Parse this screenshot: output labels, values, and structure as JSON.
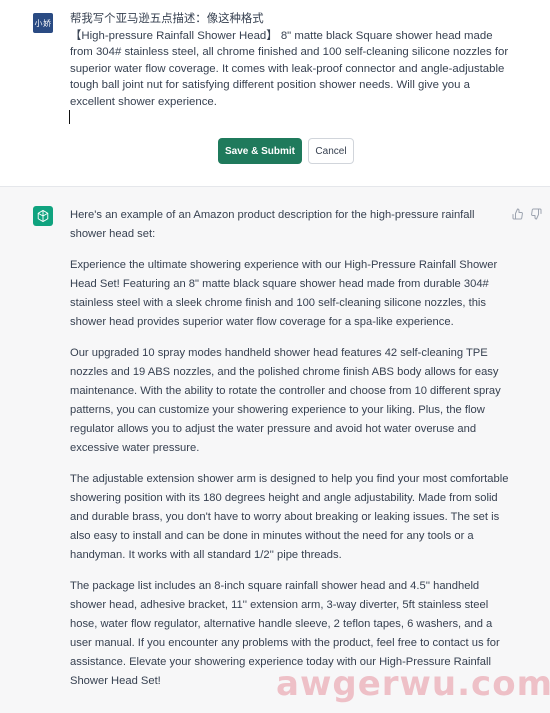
{
  "user": {
    "avatar_label": "小娇",
    "line1": "帮我写个亚马逊五点描述：像这种格式",
    "line2": "【High-pressure Rainfall Shower Head】 8\" matte black Square shower head made from 304# stainless steel, all chrome finished and 100 self-cleaning silicone nozzles for superior water flow coverage. It comes with leak-proof connector and angle-adjustable tough ball joint nut for satisfying different position shower needs. Will give you a excellent shower experience."
  },
  "buttons": {
    "save": "Save & Submit",
    "cancel": "Cancel"
  },
  "assistant": {
    "paragraphs": [
      "Here's an example of an Amazon product description for the high-pressure rainfall shower head set:",
      "Experience the ultimate showering experience with our High-Pressure Rainfall Shower Head Set! Featuring an 8\" matte black square shower head made from durable 304# stainless steel with a sleek chrome finish and 100 self-cleaning silicone nozzles, this shower head provides superior water flow coverage for a spa-like experience.",
      "Our upgraded 10 spray modes handheld shower head features 42 self-cleaning TPE nozzles and 19 ABS nozzles, and the polished chrome finish ABS body allows for easy maintenance. With the ability to rotate the controller and choose from 10 different spray patterns, you can customize your showering experience to your liking. Plus, the flow regulator allows you to adjust the water pressure and avoid hot water overuse and excessive water pressure.",
      "The adjustable extension shower arm is designed to help you find your most comfortable showering position with its 180 degrees height and angle adjustability. Made from solid and durable brass, you don't have to worry about breaking or leaking issues. The set is also easy to install and can be done in minutes without the need for any tools or a handyman. It works with all standard 1/2'' pipe threads.",
      "The package list includes an 8-inch square rainfall shower head and 4.5'' handheld shower head, adhesive bracket, 11'' extension arm, 3-way diverter, 5ft stainless steel hose, water flow regulator, alternative handle sleeve, 2 teflon tapes, 6 washers, and a user manual. If you encounter any problems with the product, feel free to contact us for assistance. Elevate your showering experience today with our High-Pressure Rainfall Shower Head Set!"
    ]
  },
  "watermark": "awgerwu.com",
  "colors": {
    "accent": "#10a37f",
    "save_button": "#1f7a5c",
    "user_avatar": "#2a4b83",
    "assistant_bg": "#f7f7f8"
  },
  "icons": [
    "chatgpt-logo-icon",
    "thumbs-up-icon",
    "thumbs-down-icon"
  ]
}
